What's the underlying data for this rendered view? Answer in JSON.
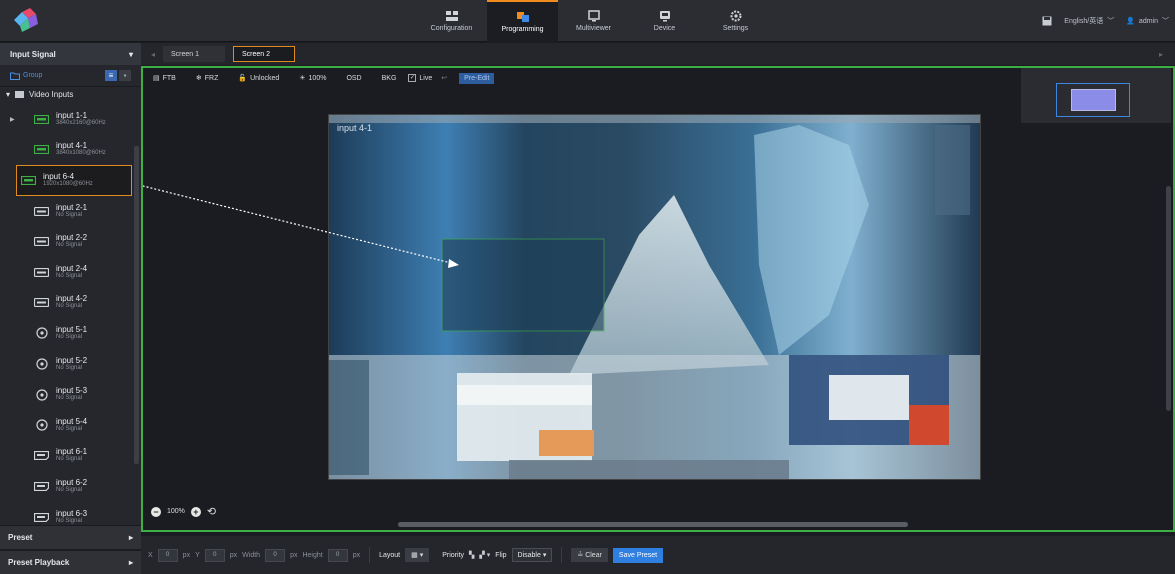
{
  "nav": {
    "items": [
      {
        "label": "Configuration",
        "icon": "grid-icon"
      },
      {
        "label": "Programming",
        "icon": "layers-icon",
        "active": true
      },
      {
        "label": "Multiviewer",
        "icon": "monitor-icon"
      },
      {
        "label": "Device",
        "icon": "device-icon"
      },
      {
        "label": "Settings",
        "icon": "gear-icon"
      }
    ],
    "language": "English/英语",
    "user": "admin"
  },
  "sidebar": {
    "title": "Input Signal",
    "group_label": "Group",
    "tree_label": "Video Inputs",
    "inputs": [
      {
        "name": "input 1-1",
        "status": "3840x2160@60Hz",
        "type": "hdmi"
      },
      {
        "name": "input 4-1",
        "status": "3840x1080@60Hz",
        "type": "hdmi"
      },
      {
        "name": "input 6-4",
        "status": "1920x1080@60Hz",
        "type": "hdmi",
        "selected": true
      },
      {
        "name": "input 2-1",
        "status": "No Signal",
        "type": "dvi"
      },
      {
        "name": "input 2-2",
        "status": "No Signal",
        "type": "dvi"
      },
      {
        "name": "input 2-4",
        "status": "No Signal",
        "type": "dvi"
      },
      {
        "name": "input 4-2",
        "status": "No Signal",
        "type": "dvi"
      },
      {
        "name": "input 5-1",
        "status": "No Signal",
        "type": "sdi"
      },
      {
        "name": "input 5-2",
        "status": "No Signal",
        "type": "sdi"
      },
      {
        "name": "input 5-3",
        "status": "No Signal",
        "type": "sdi"
      },
      {
        "name": "input 5-4",
        "status": "No Signal",
        "type": "sdi"
      },
      {
        "name": "input 6-1",
        "status": "No Signal",
        "type": "dp"
      },
      {
        "name": "input 6-2",
        "status": "No Signal",
        "type": "dp"
      },
      {
        "name": "input 6-3",
        "status": "No Signal",
        "type": "dp"
      }
    ],
    "preset_label": "Preset",
    "preset_playback_label": "Preset Playback"
  },
  "tabs": [
    "Screen 1",
    "Screen 2"
  ],
  "toolbar": {
    "ftb": "FTB",
    "frz": "FRZ",
    "unlocked": "Unlocked",
    "brightness": "100%",
    "osd": "OSD",
    "bkg": "BKG",
    "live": "Live",
    "pre_edit": "Pre-Edit"
  },
  "canvas": {
    "layer_label": "input 4-1",
    "zoom": "100%"
  },
  "bottom": {
    "x_label": "X",
    "x_value": "0",
    "y_label": "Y",
    "y_value": "0",
    "width_label": "Width",
    "width_value": "0",
    "height_label": "Height",
    "height_value": "0",
    "unit": "px",
    "layout_label": "Layout",
    "priority_label": "Priority",
    "flip_label": "Flip",
    "flip_value": "Disable",
    "clear_label": "Clear",
    "save_label": "Save Preset"
  },
  "colors": {
    "accent_orange": "#e08b1f",
    "canvas_border_green": "#3cb043",
    "button_blue": "#2f7fe0"
  }
}
